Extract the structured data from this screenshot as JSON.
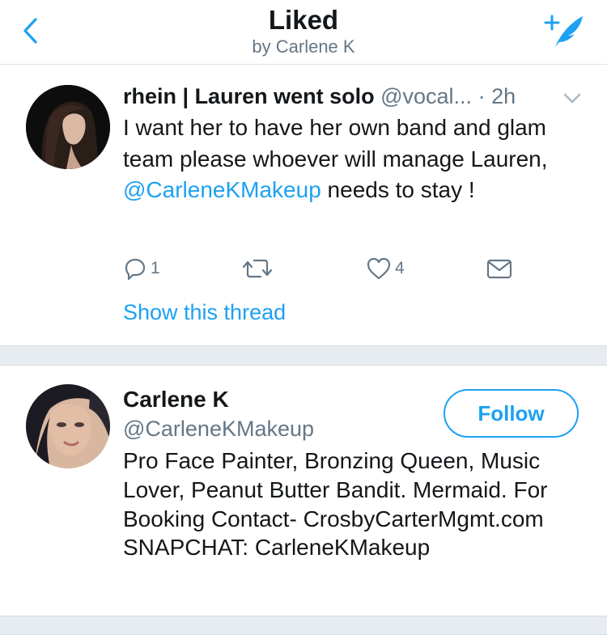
{
  "header": {
    "title": "Liked",
    "subtitle": "by Carlene K",
    "back_icon": "chevron-left-icon",
    "compose_icon": "compose-quill-icon"
  },
  "tweet": {
    "name": "rhein | Lauren went solo",
    "handle": "@vocal...",
    "time": "· 2h",
    "text_before": "I want her to have her own band and glam team please whoever will manage Lauren, ",
    "mention": "@CarleneKMakeup",
    "text_after": " needs to stay !",
    "actions": {
      "reply_count": "1",
      "retweet_count": "",
      "like_count": "4"
    },
    "show_thread": "Show this thread"
  },
  "user_card": {
    "name": "Carlene K",
    "handle": "@CarleneKMakeup",
    "follow_label": "Follow",
    "bio": "Pro Face Painter, Bronzing Queen, Music Lover, Peanut Butter Bandit. Mermaid. For Booking Contact- CrosbyCarterMgmt.com SNAPCHAT: CarleneKMakeup"
  },
  "colors": {
    "accent": "#1da1f2",
    "text": "#14171a",
    "secondary": "#657786",
    "separator": "#e6ecf0"
  }
}
